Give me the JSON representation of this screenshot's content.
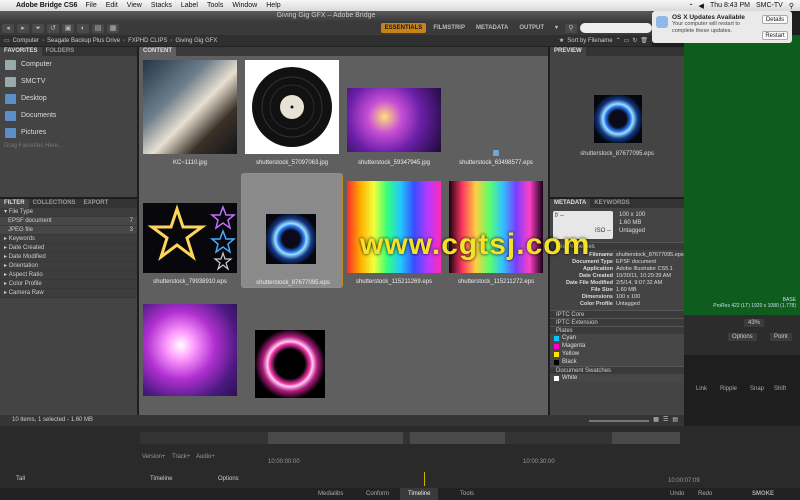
{
  "menubar": {
    "app_name": "Adobe Bridge CS6",
    "items": [
      "File",
      "Edit",
      "View",
      "Stacks",
      "Label",
      "Tools",
      "Window",
      "Help"
    ],
    "clock": "Thu 8:43 PM",
    "user": "SMC-TV"
  },
  "window": {
    "title": "Giving Gig GFX – Adobe Bridge"
  },
  "workspaces": {
    "items": [
      "ESSENTIALS",
      "FILMSTRIP",
      "METADATA",
      "OUTPUT"
    ],
    "active": 0
  },
  "search": {
    "placeholder": "▾"
  },
  "breadcrumb": [
    "Computer",
    "Seagate Backup Plus Drive",
    "FXPHD CLIPS",
    "Giving Gig GFX"
  ],
  "sort": {
    "label": "Sort by Filename"
  },
  "favorites": {
    "tabs": [
      "FAVORITES",
      "FOLDERS"
    ],
    "items": [
      "Computer",
      "SMCTV",
      "Desktop",
      "Documents",
      "Pictures"
    ],
    "hint": "Drag Favorites Here..."
  },
  "filter": {
    "tabs": [
      "FILTER",
      "COLLECTIONS",
      "EXPORT"
    ],
    "file_type_header": "File Type",
    "file_types": [
      {
        "name": "EPSF document",
        "count": "7"
      },
      {
        "name": "JPEG file",
        "count": "3"
      }
    ],
    "sections": [
      "Keywords",
      "Date Created",
      "Date Modified",
      "Orientation",
      "Aspect Ratio",
      "Color Profile",
      "Camera Raw"
    ]
  },
  "content": {
    "tab": "CONTENT",
    "items": [
      {
        "name": "KC~1110.jpg"
      },
      {
        "name": "shutterstock_57097063.jpg"
      },
      {
        "name": "shutterstock_59347945.jpg"
      },
      {
        "name": "shutterstock_63498577.eps"
      },
      {
        "name": "shutterstock_79938910.eps"
      },
      {
        "name": "shutterstock_87677095.eps"
      },
      {
        "name": "shutterstock_115211269.eps"
      },
      {
        "name": "shutterstock_115211272.eps"
      },
      {
        "name": "",
        "empty": true
      },
      {
        "name": "",
        "empty": true
      }
    ],
    "selected_index": 5
  },
  "preview": {
    "tab": "PREVIEW",
    "caption": "shutterstock_87677095.eps"
  },
  "metadata": {
    "tabs": [
      "METADATA",
      "KEYWORDS"
    ],
    "summary": {
      "f": "f/ --",
      "iso": "ISO --",
      "dims": "100 x 100",
      "size": "1.60 MB",
      "profile": "Untagged"
    },
    "file_properties_title": "File Properties",
    "rows": [
      {
        "k": "Filename",
        "v": "shutterstock_87677095.eps"
      },
      {
        "k": "Document Type",
        "v": "EPSF document"
      },
      {
        "k": "Application",
        "v": "Adobe Illustrator CS5.1"
      },
      {
        "k": "Date Created",
        "v": "10/30/11, 10:29:39 AM"
      },
      {
        "k": "Date File Modified",
        "v": "2/5/14, 9:07:32 AM"
      },
      {
        "k": "File Size",
        "v": "1.60 MB"
      },
      {
        "k": "Dimensions",
        "v": "100 x 100"
      },
      {
        "k": "Color Profile",
        "v": "Untagged"
      }
    ],
    "sections": [
      "IPTC Core",
      "IPTC Extension",
      "Plates"
    ],
    "plates": [
      {
        "name": "Cyan",
        "color": "#00c8ff"
      },
      {
        "name": "Magenta",
        "color": "#ff00c8"
      },
      {
        "name": "Yellow",
        "color": "#ffe600"
      },
      {
        "name": "Black",
        "color": "#000000"
      }
    ],
    "swatches_title": "Document Swatches",
    "swatch_first": "White"
  },
  "notification": {
    "title": "OS X Updates Available",
    "body": "Your computer will restart to complete these updates.",
    "details": "Details",
    "restart": "Restart"
  },
  "status": {
    "text": "10 items, 1 selected - 1.60 MB"
  },
  "timeline": {
    "labels": [
      "Version+",
      "Track+",
      "Audio+"
    ],
    "timecodes": [
      "10:00:00:00",
      "10:00:30:00",
      "10:00:07:09"
    ],
    "controls": [
      "Tall",
      "Timeline",
      "Options"
    ],
    "right_labels": [
      "Link",
      "Ripple",
      "Snap",
      "Shift"
    ],
    "undo": "Undo",
    "redo": "Redo",
    "smoke": "SMOKE"
  },
  "bottom_tabs": [
    "Medialibs",
    "Conform",
    "Timeline",
    "Tools"
  ],
  "video_info": {
    "line1": "BASE",
    "line2": "ProRes 422 (LT) 1920 x 1080 (1.778)",
    "zoom": "43%",
    "options": "Options",
    "point": "Point"
  },
  "watermark": "www.cgtsj.com"
}
